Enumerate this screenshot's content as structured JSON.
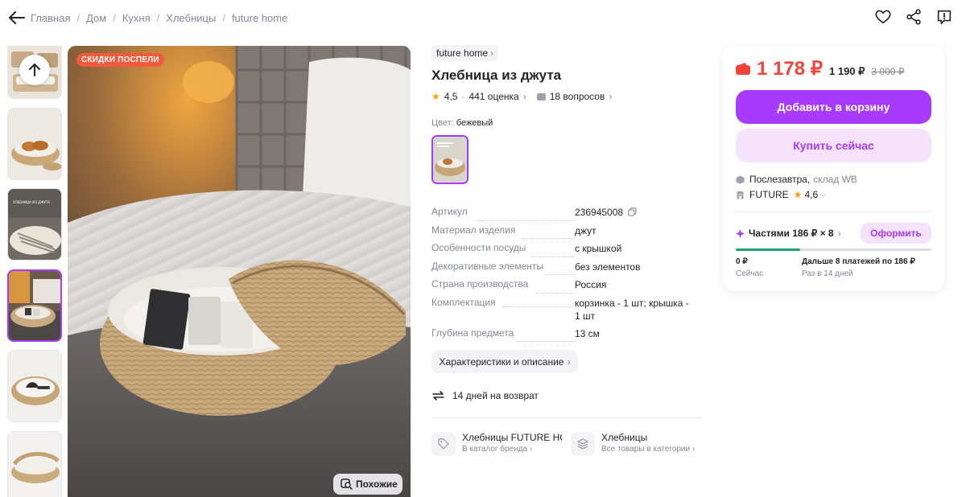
{
  "breadcrumbs": [
    "Главная",
    "Дом",
    "Кухня",
    "Хлебницы",
    "future home"
  ],
  "gallery": {
    "sale_badge": "СКИДКИ ПОСПЕЛИ",
    "similar_label": "Похожие",
    "thumbnail_text": "ХЛЕБНИЦА ИЗ ДЖУТА"
  },
  "product": {
    "brand": "future home",
    "title": "Хлебница из джута",
    "rating": "4,5",
    "ratings_count": "441 оценка",
    "questions": "18 вопросов",
    "color_label": "Цвет:",
    "color_value": "бежевый"
  },
  "specs": [
    {
      "key": "Артикул",
      "value": "236945008"
    },
    {
      "key": "Материал изделия",
      "value": "джут"
    },
    {
      "key": "Особенности посуды",
      "value": "с крышкой"
    },
    {
      "key": "Декоративные элементы",
      "value": "без элементов"
    },
    {
      "key": "Страна производства",
      "value": "Россия"
    },
    {
      "key": "Комплектация",
      "value": "корзинка - 1 шт; крышка - 1 шт"
    },
    {
      "key": "Глубина предмета",
      "value": "13 см"
    }
  ],
  "characteristics_button": "Характеристики и описание",
  "return_policy": "14 дней на возврат",
  "categories": [
    {
      "title": "Хлебницы FUTURE HOME",
      "subtitle": "В каталог бренда"
    },
    {
      "title": "Хлебницы",
      "subtitle": "Все товары в категории"
    }
  ],
  "buy": {
    "price": "1 178 ₽",
    "price_alt": "1 190 ₽",
    "price_old": "3 000 ₽",
    "add_to_cart": "Добавить в корзину",
    "buy_now": "Купить сейчас",
    "delivery_day": "Послезавтра,",
    "delivery_source": "склад WB",
    "seller_name": "FUTURE",
    "seller_rating": "4,6",
    "installments_label": "Частями 186 ₽ × 8",
    "order_button": "Оформить",
    "now_amount": "0 ₽",
    "now_label": "Сейчас",
    "later_amount": "Дальше 8 платежей по 186 ₽",
    "later_label": "Раз в 14 дней",
    "installment_progress_fraction": 0.33
  },
  "colors": {
    "accent": "#a73afd",
    "accent_light": "#f5e3fe",
    "price_red": "#f0443b",
    "sale_orange": "#f15a3d",
    "progress_green": "#1ea56b"
  }
}
